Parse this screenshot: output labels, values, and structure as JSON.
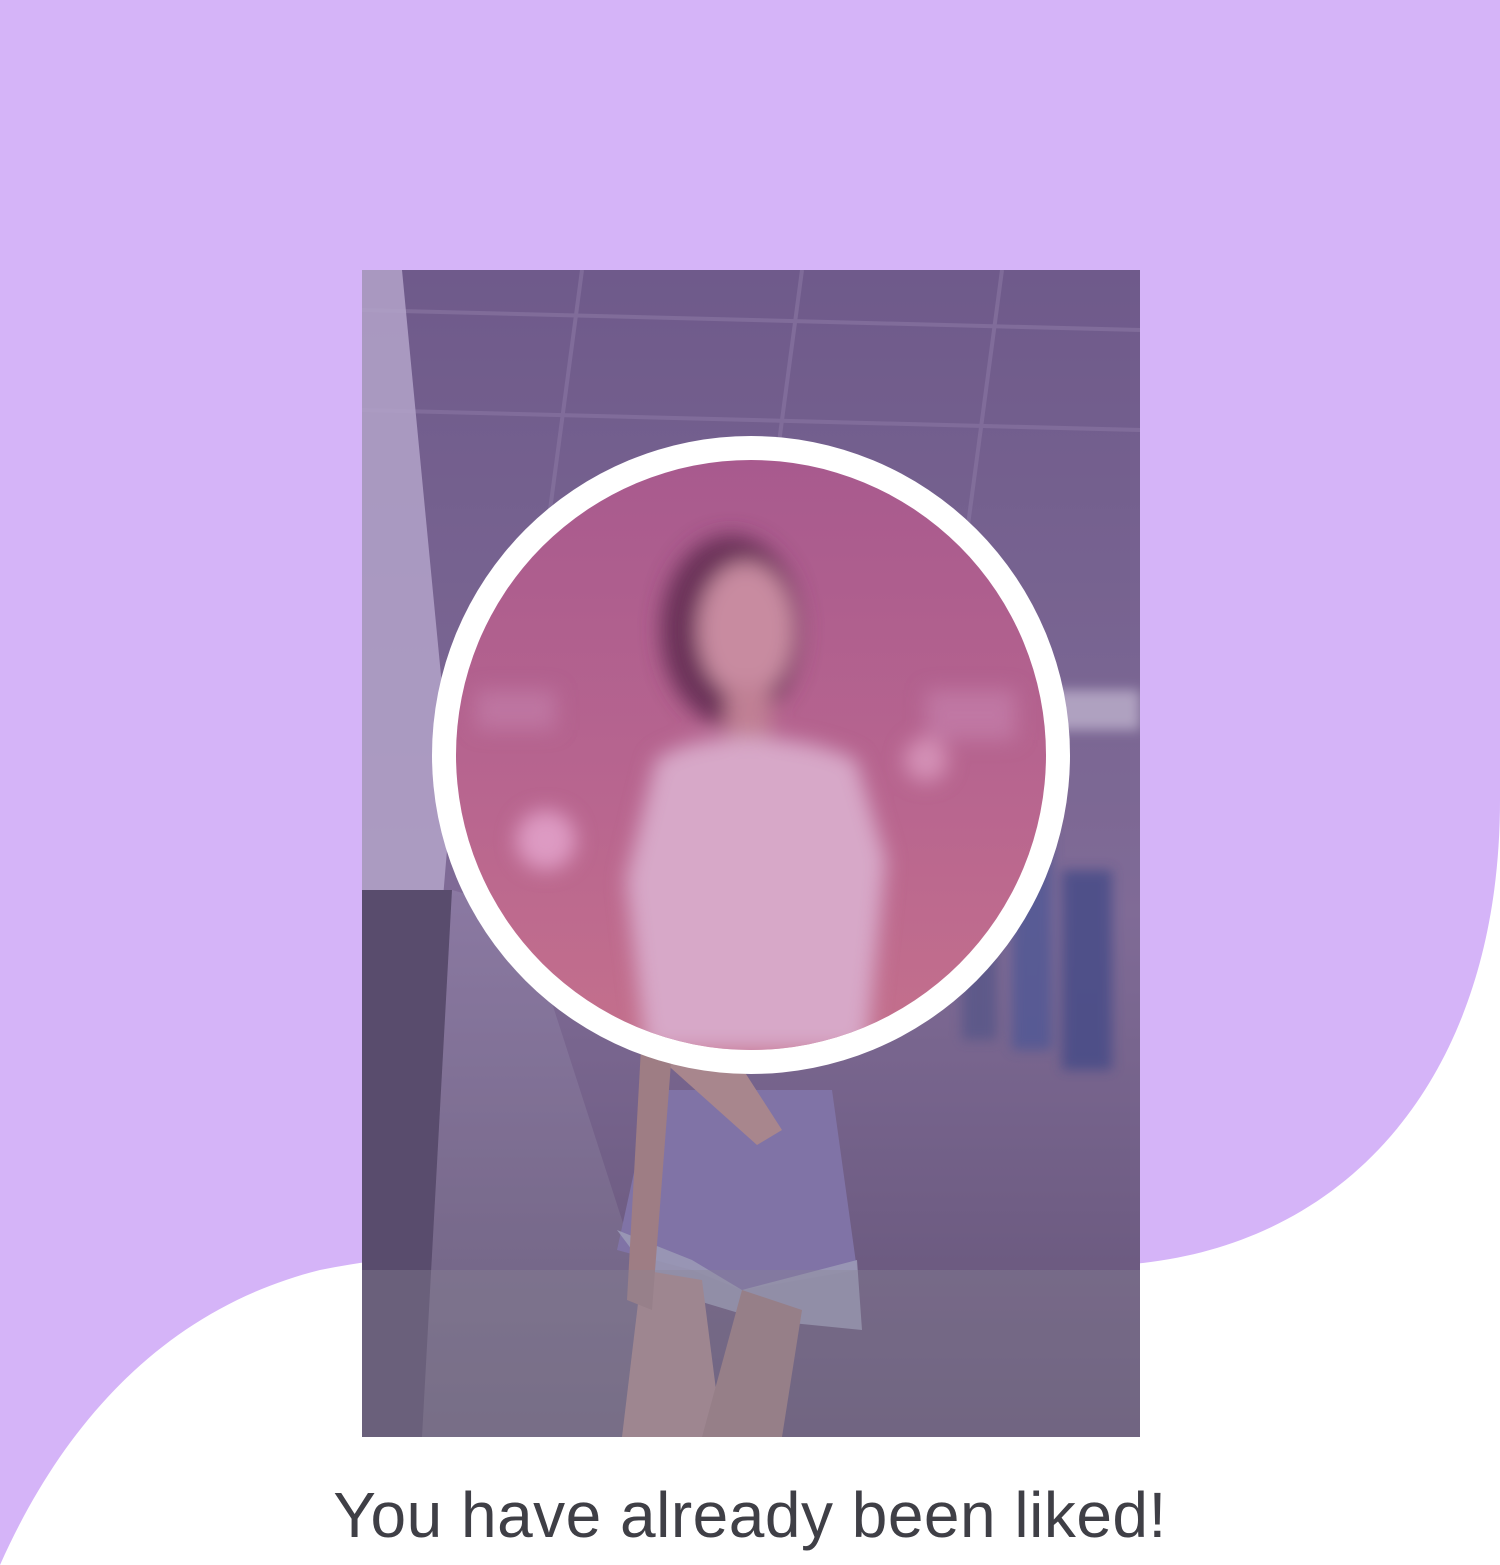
{
  "background": {
    "blob_color": "#d5b4f8",
    "base_color": "#ffffff"
  },
  "photo": {
    "icon": "person-photo",
    "overlay_color": "#6e508c"
  },
  "avatar": {
    "icon": "blurred-avatar",
    "tint_color": "#b85a91"
  },
  "status": {
    "message": "You have already been liked!"
  }
}
